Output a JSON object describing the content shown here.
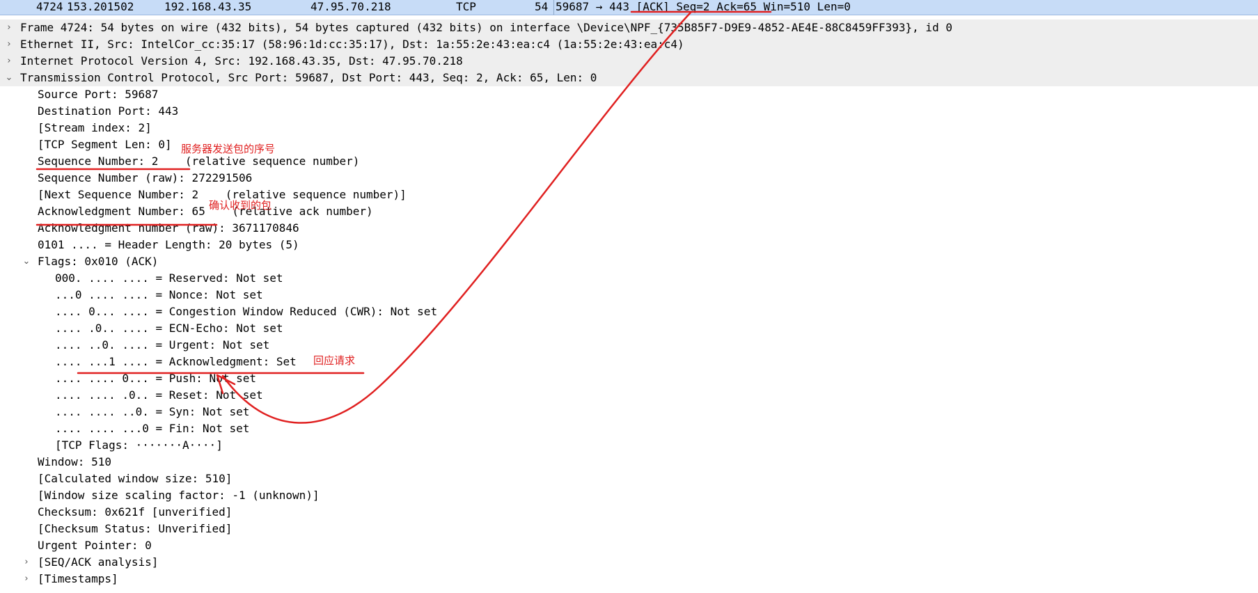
{
  "packet_row": {
    "no": "4724",
    "time": "153.201502",
    "source": "192.168.43.35",
    "destination": "47.95.70.218",
    "protocol": "TCP",
    "length": "54",
    "info": "59687 → 443 [ACK] Seq=2 Ack=65 Win=510 Len=0"
  },
  "tree": [
    {
      "id": "frame",
      "indent": 0,
      "arrow": "›",
      "text": "Frame 4724: 54 bytes on wire (432 bits), 54 bytes captured (432 bits) on interface \\Device\\NPF_{735B85F7-D9E9-4852-AE4E-88C8459FF393}, id 0"
    },
    {
      "id": "ethernet",
      "indent": 0,
      "arrow": "›",
      "text": "Ethernet II, Src: IntelCor_cc:35:17 (58:96:1d:cc:35:17), Dst: 1a:55:2e:43:ea:c4 (1a:55:2e:43:ea:c4)"
    },
    {
      "id": "ipv4",
      "indent": 0,
      "arrow": "›",
      "text": "Internet Protocol Version 4, Src: 192.168.43.35, Dst: 47.95.70.218"
    },
    {
      "id": "tcp",
      "indent": 0,
      "arrow": "⌄",
      "text": "Transmission Control Protocol, Src Port: 59687, Dst Port: 443, Seq: 2, Ack: 65, Len: 0"
    },
    {
      "id": "src-port",
      "indent": 1,
      "arrow": "",
      "text": "Source Port: 59687"
    },
    {
      "id": "dst-port",
      "indent": 1,
      "arrow": "",
      "text": "Destination Port: 443"
    },
    {
      "id": "stream-index",
      "indent": 1,
      "arrow": "",
      "text": "[Stream index: 2]"
    },
    {
      "id": "seg-len",
      "indent": 1,
      "arrow": "",
      "text": "[TCP Segment Len: 0]"
    },
    {
      "id": "seq-num",
      "indent": 1,
      "arrow": "",
      "text": "Sequence Number: 2    (relative sequence number)"
    },
    {
      "id": "seq-raw",
      "indent": 1,
      "arrow": "",
      "text": "Sequence Number (raw): 272291506"
    },
    {
      "id": "next-seq",
      "indent": 1,
      "arrow": "",
      "text": "[Next Sequence Number: 2    (relative sequence number)]"
    },
    {
      "id": "ack-num",
      "indent": 1,
      "arrow": "",
      "text": "Acknowledgment Number: 65    (relative ack number)"
    },
    {
      "id": "ack-raw",
      "indent": 1,
      "arrow": "",
      "text": "Acknowledgment number (raw): 3671170846"
    },
    {
      "id": "hdr-len",
      "indent": 1,
      "arrow": "",
      "text": "0101 .... = Header Length: 20 bytes (5)"
    },
    {
      "id": "flags",
      "indent": 1,
      "arrow": "⌄",
      "text": "Flags: 0x010 (ACK)"
    },
    {
      "id": "flag-reserved",
      "indent": 2,
      "arrow": "",
      "text": "000. .... .... = Reserved: Not set"
    },
    {
      "id": "flag-nonce",
      "indent": 2,
      "arrow": "",
      "text": "...0 .... .... = Nonce: Not set"
    },
    {
      "id": "flag-cwr",
      "indent": 2,
      "arrow": "",
      "text": ".... 0... .... = Congestion Window Reduced (CWR): Not set"
    },
    {
      "id": "flag-ecn",
      "indent": 2,
      "arrow": "",
      "text": ".... .0.. .... = ECN-Echo: Not set"
    },
    {
      "id": "flag-urg",
      "indent": 2,
      "arrow": "",
      "text": ".... ..0. .... = Urgent: Not set"
    },
    {
      "id": "flag-ack",
      "indent": 2,
      "arrow": "",
      "text": ".... ...1 .... = Acknowledgment: Set"
    },
    {
      "id": "flag-push",
      "indent": 2,
      "arrow": "",
      "text": ".... .... 0... = Push: Not set"
    },
    {
      "id": "flag-reset",
      "indent": 2,
      "arrow": "",
      "text": ".... .... .0.. = Reset: Not set"
    },
    {
      "id": "flag-syn",
      "indent": 2,
      "arrow": "",
      "text": ".... .... ..0. = Syn: Not set"
    },
    {
      "id": "flag-fin",
      "indent": 2,
      "arrow": "",
      "text": ".... .... ...0 = Fin: Not set"
    },
    {
      "id": "tcp-flags",
      "indent": 2,
      "arrow": "",
      "text": "[TCP Flags: ·······A····]"
    },
    {
      "id": "window",
      "indent": 1,
      "arrow": "",
      "text": "Window: 510"
    },
    {
      "id": "calc-window",
      "indent": 1,
      "arrow": "",
      "text": "[Calculated window size: 510]"
    },
    {
      "id": "win-scale",
      "indent": 1,
      "arrow": "",
      "text": "[Window size scaling factor: -1 (unknown)]"
    },
    {
      "id": "checksum",
      "indent": 1,
      "arrow": "",
      "text": "Checksum: 0x621f [unverified]"
    },
    {
      "id": "checksum-status",
      "indent": 1,
      "arrow": "",
      "text": "[Checksum Status: Unverified]"
    },
    {
      "id": "urgent-ptr",
      "indent": 1,
      "arrow": "",
      "text": "Urgent Pointer: 0"
    },
    {
      "id": "seqack-analysis",
      "indent": 1,
      "arrow": "›",
      "text": "[SEQ/ACK analysis]"
    },
    {
      "id": "timestamps",
      "indent": 1,
      "arrow": "›",
      "text": "[Timestamps]"
    }
  ],
  "annotations": {
    "seq_note": "服务器发送包的序号",
    "ack_note": "确认收到的包",
    "ackflag_note": "回应请求"
  },
  "colors": {
    "selected_row": "#c7dcf7",
    "expanded_band": "#eeeeee",
    "annotation": "#e02020"
  }
}
